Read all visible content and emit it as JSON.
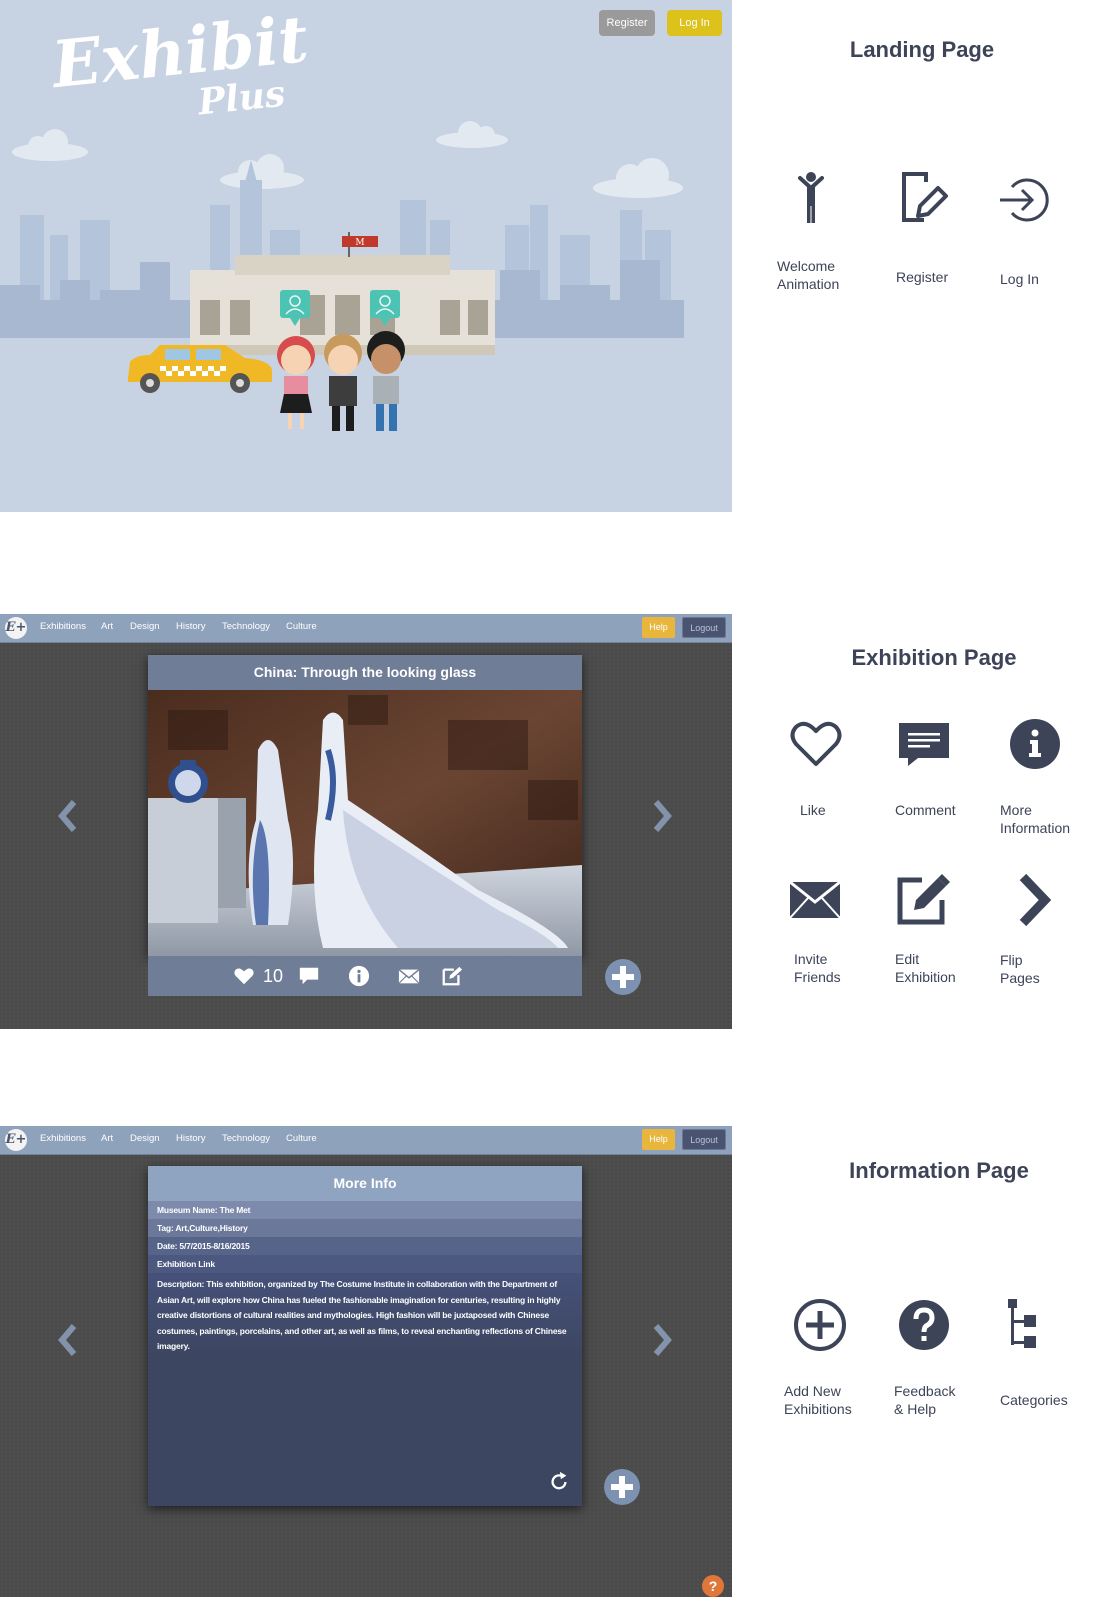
{
  "landing": {
    "logo_text": "Exhibit",
    "logo_sub": "Plus",
    "register_label": "Register",
    "login_label": "Log In",
    "flag_letter": "M"
  },
  "nav": {
    "items": [
      "Exhibitions",
      "Art",
      "Design",
      "History",
      "Technology",
      "Culture"
    ],
    "help_label": "Help",
    "logout_label": "Logout",
    "logo_glyph": "E+"
  },
  "exhibition": {
    "title": "China: Through the looking glass",
    "like_count": "10"
  },
  "info_page": {
    "title": "More Info",
    "rows": [
      "Museum Name: The Met",
      "Tag: Art,Culture,History",
      "Date: 5/7/2015-8/16/2015",
      "Exhibition Link"
    ],
    "description": "Description: This exhibition, organized by The Costume Institute in collaboration with the Department of Asian Art, will explore how China has fueled the fashionable imagination for centuries, resulting in highly creative distortions of cultural realities and mythologies. High fashion will be juxtaposed with Chinese costumes, paintings, porcelains, and other art, as well as films, to reveal enchanting reflections of Chinese imagery.",
    "help_glyph": "?"
  },
  "legend": {
    "landing_title": "Landing Page",
    "landing_items": [
      {
        "icon": "person-icon",
        "label": "Welcome\nAnimation"
      },
      {
        "icon": "register-icon",
        "label": "Register"
      },
      {
        "icon": "login-icon",
        "label": "Log In"
      }
    ],
    "exhibition_title": "Exhibition Page",
    "exhibition_items": [
      {
        "icon": "heart-icon",
        "label": "Like"
      },
      {
        "icon": "comment-icon",
        "label": "Comment"
      },
      {
        "icon": "info-icon",
        "label": "More\nInformation"
      },
      {
        "icon": "envelope-icon",
        "label": "Invite\nFriends"
      },
      {
        "icon": "edit-icon",
        "label": "Edit\nExhibition"
      },
      {
        "icon": "chevron-right-icon",
        "label": "Flip\nPages"
      }
    ],
    "info_title": "Information Page",
    "info_items": [
      {
        "icon": "plus-circle-icon",
        "label": "Add New\nExhibitions"
      },
      {
        "icon": "question-icon",
        "label": "Feedback\n& Help"
      },
      {
        "icon": "categories-icon",
        "label": "Categories"
      }
    ]
  },
  "colors": {
    "landing_bg": "#c7d2e2",
    "navbar": "#8ea2bc",
    "help": "#e8b63c",
    "login": "#dcc21a",
    "icon_dark": "#3d4458",
    "teal_badge": "#4cc3b3",
    "taxi": "#f1b825"
  }
}
